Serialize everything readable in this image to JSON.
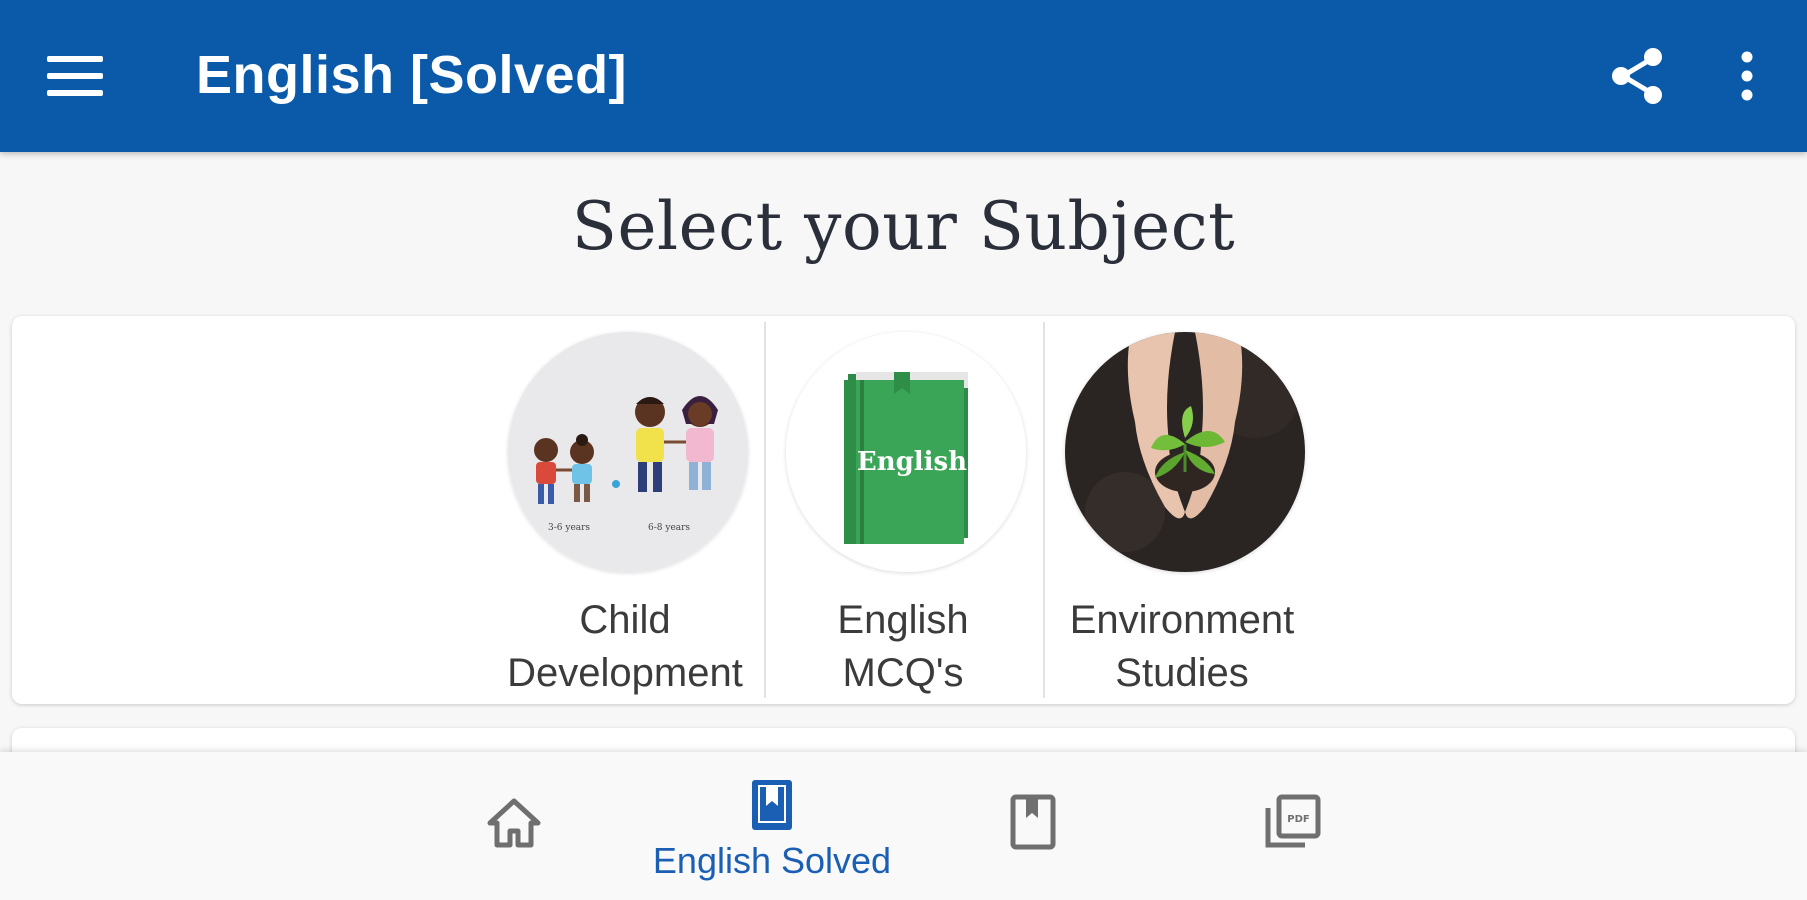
{
  "app_bar": {
    "title": "English [Solved]",
    "menu_icon": "hamburger-menu-icon",
    "share_icon": "share-icon",
    "more_icon": "more-vertical-icon",
    "background_color": "#0a5aa9"
  },
  "page": {
    "heading": "Select your Subject"
  },
  "subjects": [
    {
      "label_line1": "Child",
      "label_line2": "Development",
      "image_caption_left": "3-6 years",
      "image_caption_right": "6-8 years"
    },
    {
      "label_line1": "English",
      "label_line2": "MCQ's",
      "book_title": "English"
    },
    {
      "label_line1": "Environment",
      "label_line2": "Studies"
    }
  ],
  "bottom_nav": {
    "active_color": "#1b5fb5",
    "items": [
      {
        "icon": "home-icon",
        "label": ""
      },
      {
        "icon": "bookmark-book-icon",
        "label": "English Solved",
        "active": true
      },
      {
        "icon": "book-icon",
        "label": ""
      },
      {
        "icon": "pdf-icon",
        "label": ""
      }
    ]
  }
}
